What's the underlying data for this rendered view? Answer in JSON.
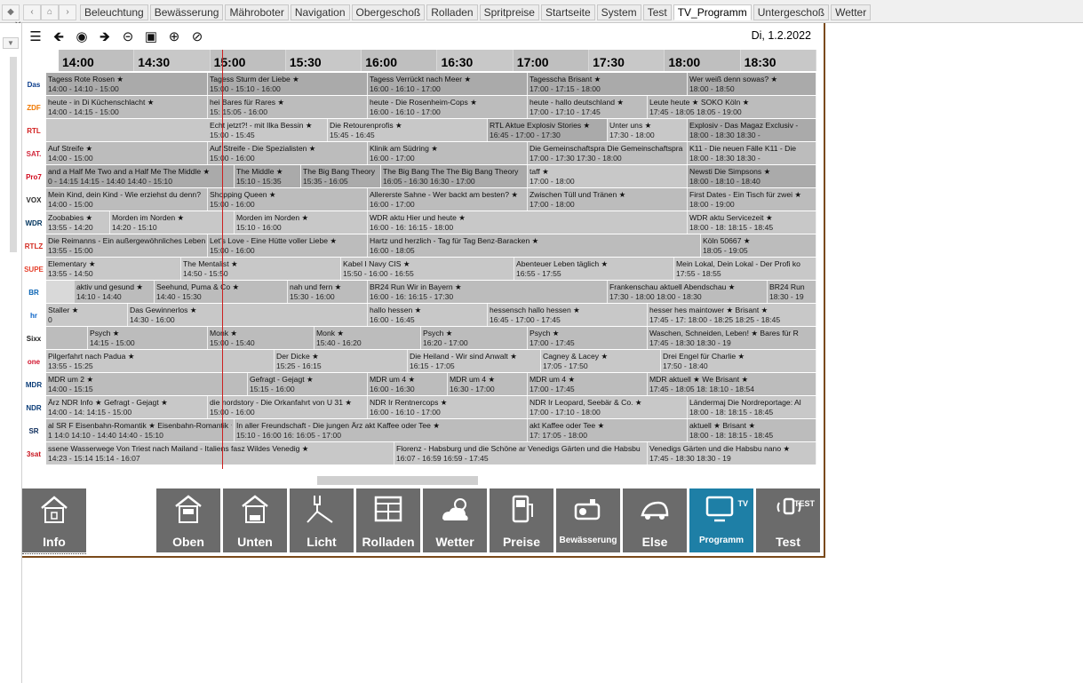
{
  "tabs": {
    "items": [
      "Beleuchtung",
      "Bewässerung",
      "Mähroboter",
      "Navigation",
      "Obergeschoß",
      "Rolladen",
      "Spritpreise",
      "Startseite",
      "System",
      "Test",
      "TV_Programm",
      "Untergeschoß",
      "Wetter"
    ],
    "active": "TV_Programm"
  },
  "date": "Di, 1.2.2022",
  "hours": [
    "14:00",
    "14:30",
    "15:00",
    "15:30",
    "16:00",
    "16:30",
    "17:00",
    "17:30",
    "18:00",
    "18:30"
  ],
  "channels": [
    {
      "logo": "Das Erste",
      "color": "#0a3c8c",
      "progs": [
        [
          0,
          "Tagess Rote Rosen ★",
          "14:00 - 14:10 - 15:00",
          2
        ],
        [
          182,
          "Tagess Sturm der Liebe ★",
          "15:00 - 15:10 - 16:00",
          2
        ],
        [
          362,
          "Tagess Verrückt nach Meer ★",
          "16:00 - 16:10 - 17:00",
          2
        ],
        [
          542,
          "Tagesscha Brisant ★",
          "17:00 - 17:15 - 18:00",
          2
        ],
        [
          722,
          "Wer weiß denn sowas? ★",
          "18:00 - 18:50",
          0
        ]
      ]
    },
    {
      "logo": "ZDF",
      "color": "#f07800",
      "progs": [
        [
          0,
          "heute - in Di Küchenschlacht ★",
          "14:00 - 14:15 - 15:00",
          2
        ],
        [
          182,
          "hei Bares für Rares ★",
          "15: 15:05 - 16:00",
          2
        ],
        [
          362,
          "heute - Die Rosenheim-Cops ★",
          "16:00 - 16:10 - 17:00",
          2
        ],
        [
          542,
          "heute - hallo deutschland ★",
          "17:00 - 17:10 - 17:45",
          2
        ],
        [
          677,
          "Leute heute ★ SOKO Köln ★",
          "17:45 - 18:05 18:05 - 19:00",
          2
        ]
      ]
    },
    {
      "logo": "RTL",
      "color": "#d21e1e",
      "progs": [
        [
          182,
          "Echt jetzt?! - mit Ilka Bessin ★",
          "15:00 - 15:45",
          1
        ],
        [
          317,
          "Die Retourenprofis ★",
          "15:45 - 16:45",
          1
        ],
        [
          497,
          "RTL Aktue Explosiv Stories ★",
          "16:45 - 17:00 - 17:30",
          2
        ],
        [
          632,
          "Unter uns ★",
          "17:30 - 18:00",
          1
        ],
        [
          722,
          "Explosiv - Das Magaz Exclusiv -",
          "18:00 - 18:30 18:30 -",
          2
        ]
      ]
    },
    {
      "logo": "SAT.1",
      "color": "#d2283c",
      "progs": [
        [
          0,
          "Auf Streife ★",
          "14:00 - 15:00",
          2
        ],
        [
          182,
          "Auf Streife - Die Spezialisten ★",
          "15:00 - 16:00",
          2
        ],
        [
          362,
          "Klinik am Südring ★",
          "16:00 - 17:00",
          2
        ],
        [
          542,
          "Die Gemeinschaftspra Die Gemeinschaftspra",
          "17:00 - 17:30 17:30 - 18:00",
          2
        ],
        [
          722,
          "K11 - Die neuen Fälle K11 - Die",
          "18:00 - 18:30 18:30 -",
          2
        ]
      ]
    },
    {
      "logo": "Pro7",
      "color": "#d20a1e",
      "progs": [
        [
          0,
          "and a Half Me Two and a Half Me The Middle ★",
          "0 - 14:15 14:15 - 14:40 14:40 - 15:10",
          2
        ],
        [
          212,
          "The Middle ★",
          "15:10 - 15:35",
          2
        ],
        [
          287,
          "The Big Bang Theory",
          "15:35 - 16:05",
          2
        ],
        [
          377,
          "The Big Bang The The Big Bang Theory",
          "16:05 - 16:30 16:30 - 17:00",
          2
        ],
        [
          542,
          "taff ★",
          "17:00 - 18:00",
          1
        ],
        [
          722,
          "Newsti Die Simpsons ★",
          "18:00 - 18:10 - 18:40",
          2
        ]
      ]
    },
    {
      "logo": "VOX",
      "color": "#2a2a2a",
      "progs": [
        [
          0,
          "Mein Kind, dein Kind - Wie erziehst du denn?",
          "14:00 - 15:00",
          2
        ],
        [
          182,
          "Shopping Queen ★",
          "15:00 - 16:00",
          2
        ],
        [
          362,
          "Allererste Sahne - Wer backt am besten? ★",
          "16:00 - 17:00",
          2
        ],
        [
          542,
          "Zwischen Tüll und Tränen ★",
          "17:00 - 18:00",
          2
        ],
        [
          722,
          "First Dates - Ein Tisch für zwei ★",
          "18:00 - 19:00",
          2
        ]
      ]
    },
    {
      "logo": "WDR",
      "color": "#00345e",
      "progs": [
        [
          0,
          "Zoobabies ★",
          "13:55 - 14:20",
          1
        ],
        [
          72,
          "Morden im Norden ★",
          "14:20 - 15:10",
          1
        ],
        [
          212,
          "Morden im Norden ★",
          "15:10 - 16:00",
          1
        ],
        [
          362,
          "WDR aktu Hier und heute ★",
          "16:00 - 16: 16:15 - 18:00",
          1
        ],
        [
          722,
          "WDR aktu Servicezeit ★",
          "18:00 - 18: 18:15 - 18:45",
          1
        ]
      ]
    },
    {
      "logo": "RTLZWEI",
      "color": "#d2281e",
      "progs": [
        [
          0,
          "Die Reimanns - Ein außergewöhnliches Leben ★",
          "13:55 - 15:00",
          2
        ],
        [
          182,
          "Let's Love - Eine Hütte voller Liebe ★",
          "15:00 - 16:00",
          2
        ],
        [
          362,
          "Hartz und herzlich - Tag für Tag Benz-Baracken ★",
          "16:00 - 18:05",
          2
        ],
        [
          737,
          "Köln 50667 ★",
          "18:05 - 19:05",
          2
        ]
      ]
    },
    {
      "logo": "SUPER RTL",
      "color": "#e6412d",
      "progs": [
        [
          0,
          "Elementary ★",
          "13:55 - 14:50",
          1
        ],
        [
          152,
          "The Mentalist ★",
          "14:50 - 15:50",
          1
        ],
        [
          332,
          "Kabel I Navy CIS ★",
          "15:50 - 16:00 - 16:55",
          1
        ],
        [
          527,
          "Abenteuer Leben täglich ★",
          "16:55 - 17:55",
          1
        ],
        [
          707,
          "Mein Lokal, Dein Lokal - Der Profi ko",
          "17:55 - 18:55",
          1
        ]
      ]
    },
    {
      "logo": "BR",
      "color": "#0a64b4",
      "progs": [
        [
          32,
          "aktiv und gesund ★",
          "14:10 - 14:40",
          2
        ],
        [
          122,
          "Seehund, Puma & Co ★",
          "14:40 - 15:30",
          2
        ],
        [
          272,
          "nah und fern ★",
          "15:30 - 16:00",
          2
        ],
        [
          362,
          "BR24 Run Wir in Bayern ★",
          "16:00 - 16: 16:15 - 17:30",
          2
        ],
        [
          632,
          "Frankenschau aktuell Abendschau ★",
          "17:30 - 18:00 18:00 - 18:30",
          2
        ],
        [
          812,
          "BR24 Run",
          "18:30 - 19",
          2
        ]
      ]
    },
    {
      "logo": "hr",
      "color": "#0a64c8",
      "progs": [
        [
          0,
          "Staller ★",
          "0",
          1
        ],
        [
          92,
          "Das Gewinnerlos ★",
          "14:30 - 16:00",
          1
        ],
        [
          362,
          "hallo hessen ★",
          "16:00 - 16:45",
          1
        ],
        [
          497,
          "hessensch hallo hessen ★",
          "16:45 - 17:00 - 17:45",
          1
        ],
        [
          677,
          "hesser hes maintower ★ Brisant ★",
          "17:45 - 17: 18:00 - 18:25 18:25 - 18:45",
          1
        ]
      ]
    },
    {
      "logo": "Sixx",
      "color": "#1a1a1a",
      "progs": [
        [
          0,
          "",
          "",
          2
        ],
        [
          47,
          "Psych ★",
          "14:15 - 15:00",
          2
        ],
        [
          182,
          "Monk ★",
          "15:00 - 15:40",
          2
        ],
        [
          302,
          "Monk ★",
          "15:40 - 16:20",
          2
        ],
        [
          422,
          "Psych ★",
          "16:20 - 17:00",
          2
        ],
        [
          542,
          "Psych ★",
          "17:00 - 17:45",
          2
        ],
        [
          677,
          "Waschen, Schneiden, Leben! ★ Bares für R",
          "17:45 - 18:30 18:30 - 19",
          2
        ]
      ]
    },
    {
      "logo": "one",
      "color": "#d2142d",
      "progs": [
        [
          0,
          "Pilgerfahrt nach Padua ★",
          "13:55 - 15:25",
          1
        ],
        [
          257,
          "Der Dicke ★",
          "15:25 - 16:15",
          1
        ],
        [
          407,
          "Die Heiland - Wir sind Anwalt ★",
          "16:15 - 17:05",
          1
        ],
        [
          557,
          "Cagney & Lacey ★",
          "17:05 - 17:50",
          1
        ],
        [
          692,
          "Drei Engel für Charlie ★",
          "17:50 - 18:40",
          1
        ]
      ]
    },
    {
      "logo": "MDR",
      "color": "#0a3c78",
      "progs": [
        [
          0,
          "MDR um 2 ★",
          "14:00 - 15:15",
          2
        ],
        [
          227,
          "Gefragt - Gejagt ★",
          "15:15 - 16:00",
          2
        ],
        [
          362,
          "MDR um 4 ★",
          "16:00 - 16:30",
          2
        ],
        [
          452,
          "MDR um 4 ★",
          "16:30 - 17:00",
          2
        ],
        [
          542,
          "MDR um 4 ★",
          "17:00 - 17:45",
          2
        ],
        [
          677,
          "MDR aktuell ★ We Brisant ★",
          "17:45 - 18:05 18: 18:10 - 18:54",
          2
        ]
      ]
    },
    {
      "logo": "NDR",
      "color": "#0a3c78",
      "progs": [
        [
          0,
          "Ärz NDR Info ★ Gefragt - Gejagt ★",
          "14:00 - 14: 14:15 - 15:00",
          1
        ],
        [
          182,
          "die nordstory - Die Orkanfahrt von U 31 ★",
          "15:00 - 16:00",
          1
        ],
        [
          362,
          "NDR Ir Rentnercops ★",
          "16:00 - 16:10 - 17:00",
          1
        ],
        [
          542,
          "NDR Ir Leopard, Seebär & Co. ★",
          "17:00 - 17:10 - 18:00",
          1
        ],
        [
          722,
          "Ländermaj Die Nordreportage: Al",
          "18:00 - 18: 18:15 - 18:45",
          1
        ]
      ]
    },
    {
      "logo": "SR",
      "color": "#0a2a5a",
      "progs": [
        [
          0,
          "al SR F Eisenbahn-Romantik ★ Eisenbahn-Romantik ★",
          "1 14:0 14:10 - 14:40 14:40 - 15:10",
          2
        ],
        [
          212,
          "In aller Freundschaft - Die jungen Ärz akt Kaffee oder Tee ★",
          "15:10 - 16:00 16: 16:05 - 17:00",
          2
        ],
        [
          542,
          "akt Kaffee oder Tee ★",
          "17: 17:05 - 18:00",
          2
        ],
        [
          722,
          "aktuell ★ Brisant ★",
          "18:00 - 18: 18:15 - 18:45",
          2
        ]
      ]
    },
    {
      "logo": "3sat",
      "color": "#c8141e",
      "progs": [
        [
          0,
          "ssene Wasserwege Von Triest nach Mailand - Italiens fasz Wildes Venedig ★",
          "14:23 - 15:14 15:14 - 16:07",
          1
        ],
        [
          392,
          "Florenz - Habsburg und die Schöne ar Venedigs Gärten und die Habsbu",
          "16:07 - 16:59 16:59 - 17:45",
          1
        ],
        [
          677,
          "Venedigs Gärten und die Habsbu nano ★",
          "17:45 - 18:30 18:30 - 19",
          1
        ]
      ]
    }
  ],
  "dock": [
    {
      "label": "Info",
      "icon": "home-info-icon"
    },
    {
      "label": "Oben",
      "icon": "house-og-icon"
    },
    {
      "label": "Unten",
      "icon": "house-eg-icon"
    },
    {
      "label": "Licht",
      "icon": "lamp-icon"
    },
    {
      "label": "Rolladen",
      "icon": "shutter-icon"
    },
    {
      "label": "Wetter",
      "icon": "weather-icon"
    },
    {
      "label": "Preise",
      "icon": "fuel-pump-icon"
    },
    {
      "label": "Bewässerung",
      "icon": "pump-icon"
    },
    {
      "label": "Else",
      "icon": "lawnmower-icon"
    },
    {
      "label": "Programm",
      "icon": "tv-icon",
      "badge": "TV"
    },
    {
      "label": "Test",
      "icon": "test-icon",
      "badge": "TEST"
    }
  ],
  "colors": {
    "accent": "#1e7fa6",
    "dock": "#6b6b6b",
    "frame": "#7a4a1a",
    "nowline": "#cc2020"
  }
}
